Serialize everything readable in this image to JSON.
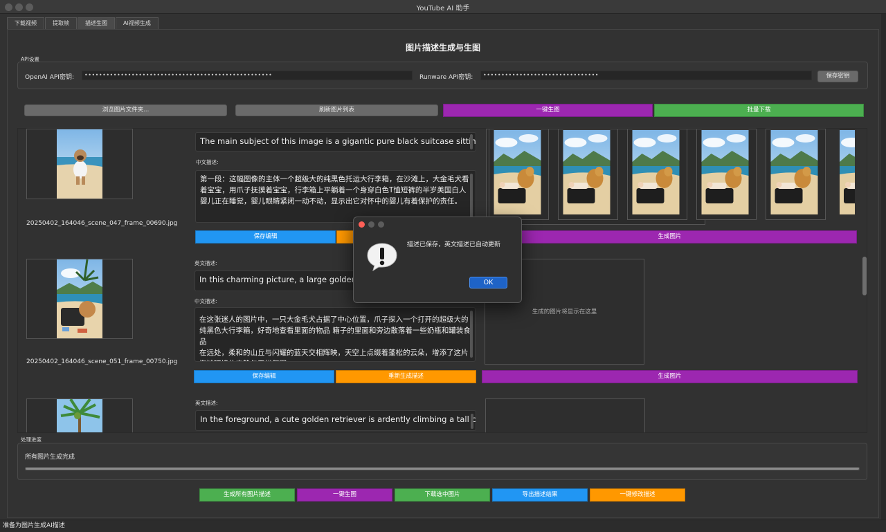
{
  "window": {
    "title": "YouTube AI 助手"
  },
  "tabs": [
    "下载视频",
    "提取帧",
    "描述生图",
    "AI视频生成"
  ],
  "page_title": "图片描述生成与生图",
  "api": {
    "group_label": "API设置",
    "openai_label": "OpenAI API密钥:",
    "openai_value": "••••••••••••••••••••••••••••••••••••••••••••••••••••",
    "runware_label": "Runware API密钥:",
    "runware_value": "••••••••••••••••••••••••••••••••",
    "save_key": "保存密钥"
  },
  "toolbar": {
    "browse": "浏览图片文件夹...",
    "refresh": "刷新图片列表",
    "one_click": "一键生图",
    "batch_download": "批量下载"
  },
  "labels": {
    "en": "英文描述:",
    "zh": "中文描述:",
    "save_edit": "保存编辑",
    "regen": "重新生成描述",
    "gen_image": "生成图片",
    "placeholder": "生成的图片将显示在这里"
  },
  "rows": [
    {
      "filename": "20250402_164046_scene_047_frame_00690.jpg",
      "en_text": "The main subject of this image is a gigantic pure black suitcase sitting on the beach, beside which a golden retriever is resting at a baby",
      "zh_text": "第一段：这幅图像的主体一个超级大的纯黑色托运大行李箱，在沙滩上，大金毛犬看着宝宝，用爪子抚摸着宝宝，行李箱上平躺着一个身穿白色T恤短裤的半岁美国白人婴儿正在睡觉，婴儿眼睛紧闭一动不动，显示出它对怀中的婴儿有着保护的责任。"
    },
    {
      "filename": "20250402_164046_scene_051_frame_00750.jpg",
      "en_text": "In this charming picture, a large golden retriever dog, sitting in the center, is curiously looking into an open",
      "zh_text": "在这张迷人的图片中，一只大金毛犬占据了中心位置，爪子探入一个打开的超级大的纯黑色大行李箱，好奇地查看里面的物品 箱子的里面和旁边散落着一些奶瓶和罐装食品\n在远处，柔和的山丘与闪耀的蓝天交相辉映，天空上点缀着蓬松的云朵，增添了这片海滩环境的宁静与无忧氛围。"
    },
    {
      "en_text": "In the foreground, a cute golden retriever is ardently climbing a tall coconut tree, its sturdy back and short legs create a humorous"
    }
  ],
  "progress": {
    "group_label": "处理进度",
    "status": "所有图片生成完成",
    "value": 100
  },
  "bottom": {
    "gen_all": "生成所有图片描述",
    "one_click": "一键生图",
    "download_selected": "下载选中图片",
    "export": "导出描述结果",
    "fix_all": "一键修改描述"
  },
  "dialog": {
    "message": "描述已保存，英文描述已自动更新",
    "ok": "OK",
    "icon": "alert-icon"
  },
  "status_bar": "准备为图片生成AI描述",
  "colors": {
    "purple": "#9c27b0",
    "green": "#4caf50",
    "blue": "#2196f3",
    "orange": "#ff9800"
  }
}
